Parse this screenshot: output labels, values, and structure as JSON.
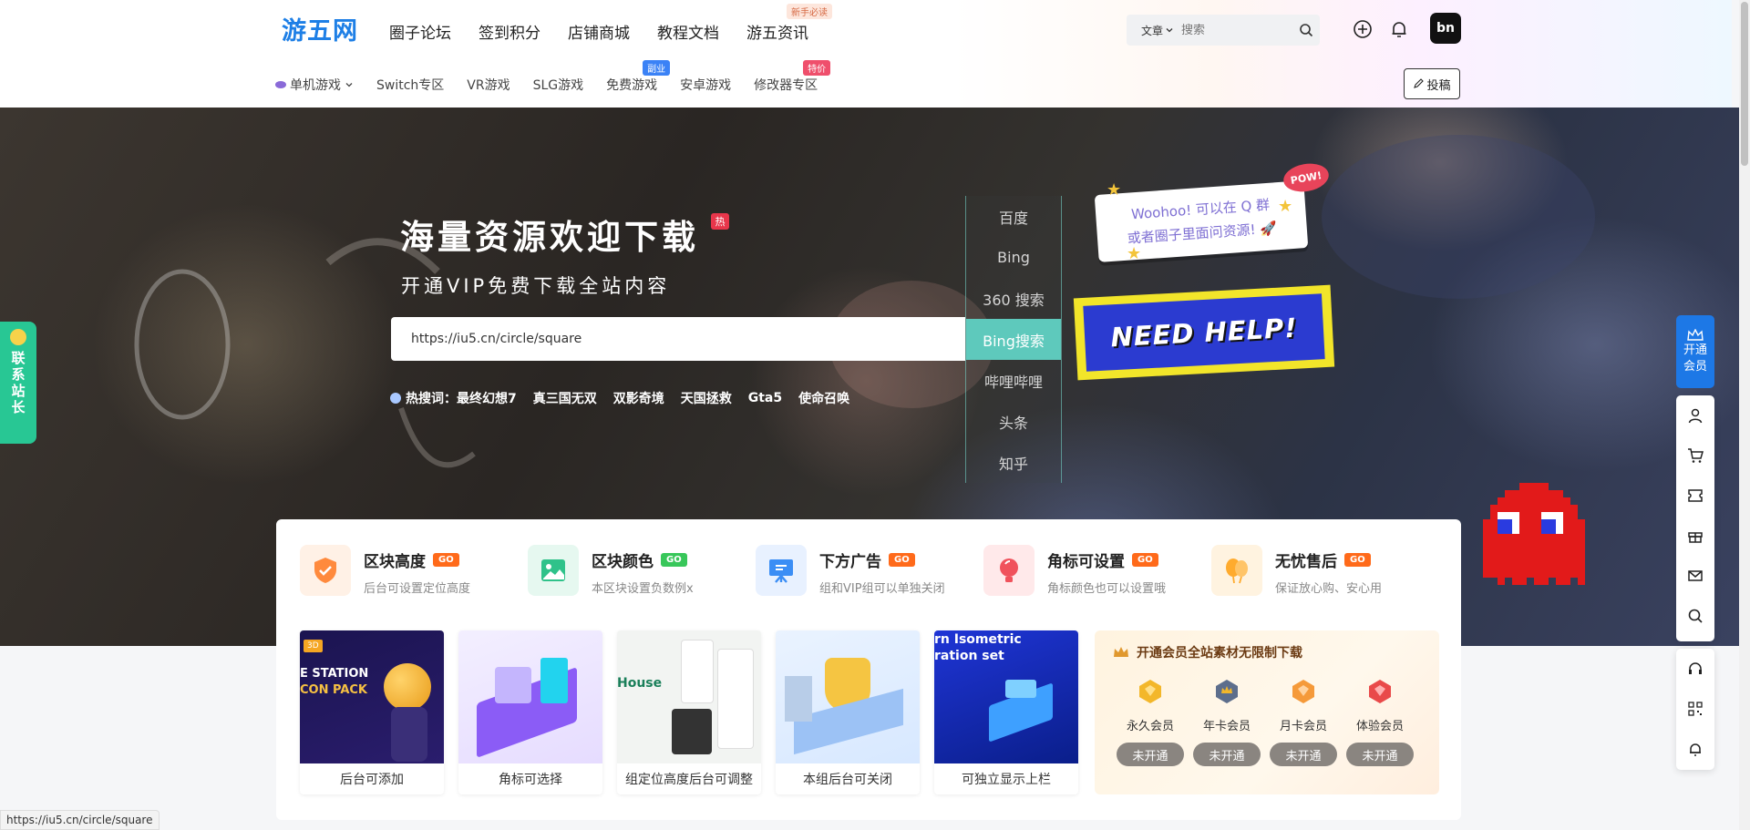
{
  "header": {
    "logo": "游五网",
    "nav": [
      {
        "label": "圈子论坛"
      },
      {
        "label": "签到积分"
      },
      {
        "label": "店铺商城"
      },
      {
        "label": "教程文档"
      },
      {
        "label": "游五资讯",
        "badge": "新手必读"
      }
    ],
    "search": {
      "type_label": "文章",
      "placeholder": "搜索"
    },
    "avatar_text": "bn"
  },
  "subnav": {
    "items": [
      {
        "label": "单机游戏"
      },
      {
        "label": "Switch专区"
      },
      {
        "label": "VR游戏"
      },
      {
        "label": "SLG游戏"
      },
      {
        "label": "免费游戏",
        "tag": "副业",
        "tag_color": "#3b82f6"
      },
      {
        "label": "安卓游戏"
      },
      {
        "label": "修改器专区",
        "tag": "特价",
        "tag_color": "#ef4f6c"
      }
    ],
    "post_button": "投稿"
  },
  "hero": {
    "title": "海量资源欢迎下载",
    "hot_badge": "热",
    "subtitle": "开通VIP免费下载全站内容",
    "search_value": "https://iu5.cn/circle/square",
    "engines": [
      "百度",
      "Bing",
      "360 搜索",
      "Bing搜索",
      "哔哩哔哩",
      "头条",
      "知乎"
    ],
    "active_engine_index": 3,
    "hot_label": "热搜词：",
    "hot_words": [
      "最终幻想7",
      "真三国无双",
      "双影奇境",
      "天国拯救",
      "Gta5",
      "使命召唤"
    ],
    "bubble_line1": "Woohoo! 可以在 Q 群",
    "bubble_line2": "或者圈子里面问资源! 🚀",
    "pow": "POW!",
    "need_help": "NEED HELP!"
  },
  "contact_tab": "联系站长",
  "features": [
    {
      "title": "区块高度",
      "go": "GO",
      "desc": "后台可设置定位高度",
      "color": "#ff8a3d",
      "bg": "#fff1e6",
      "go_color": "#ff6a1a"
    },
    {
      "title": "区块颜色",
      "go": "GO",
      "desc": "本区块设置负数例x",
      "color": "#2fc28a",
      "bg": "#e6f8f0",
      "go_color": "#38c75a"
    },
    {
      "title": "下方广告",
      "go": "GO",
      "desc": "组和VIP组可以单独关闭",
      "color": "#3b8ef5",
      "bg": "#e8f1ff",
      "go_color": "#ff6a1a"
    },
    {
      "title": "角标可设置",
      "go": "GO",
      "desc": "角标颜色也可以设置哦",
      "color": "#f0525c",
      "bg": "#ffe9ea",
      "go_color": "#ff6a1a"
    },
    {
      "title": "无忧售后",
      "go": "GO",
      "desc": "保证放心购、安心用",
      "color": "#ffab2e",
      "bg": "#fff3e0",
      "go_color": "#ff6a1a"
    }
  ],
  "thumbs": [
    {
      "caption": "后台可添加",
      "art_line1": "E STATION",
      "art_line2": "CON PACK",
      "badge": "3D"
    },
    {
      "caption": "角标可选择"
    },
    {
      "caption": "组定位高度后台可调整",
      "art_line1": "House"
    },
    {
      "caption": "本组后台可关闭"
    },
    {
      "caption": "可独立显示上栏",
      "art_line1": "rn Isometric",
      "art_line2": "ration set"
    }
  ],
  "vip": {
    "header": "开通会员全站素材无限制下载",
    "tiers": [
      {
        "name": "永久会员",
        "button": "未开通",
        "color": "#f3b72a"
      },
      {
        "name": "年卡会员",
        "button": "未开通",
        "color": "#5d6e8c"
      },
      {
        "name": "月卡会员",
        "button": "未开通",
        "color": "#f59a3a"
      },
      {
        "name": "体验会员",
        "button": "未开通",
        "color": "#e94a4a"
      }
    ]
  },
  "float": {
    "vip_line1": "开通",
    "vip_line2": "会员"
  },
  "status_url": "https://iu5.cn/circle/square"
}
